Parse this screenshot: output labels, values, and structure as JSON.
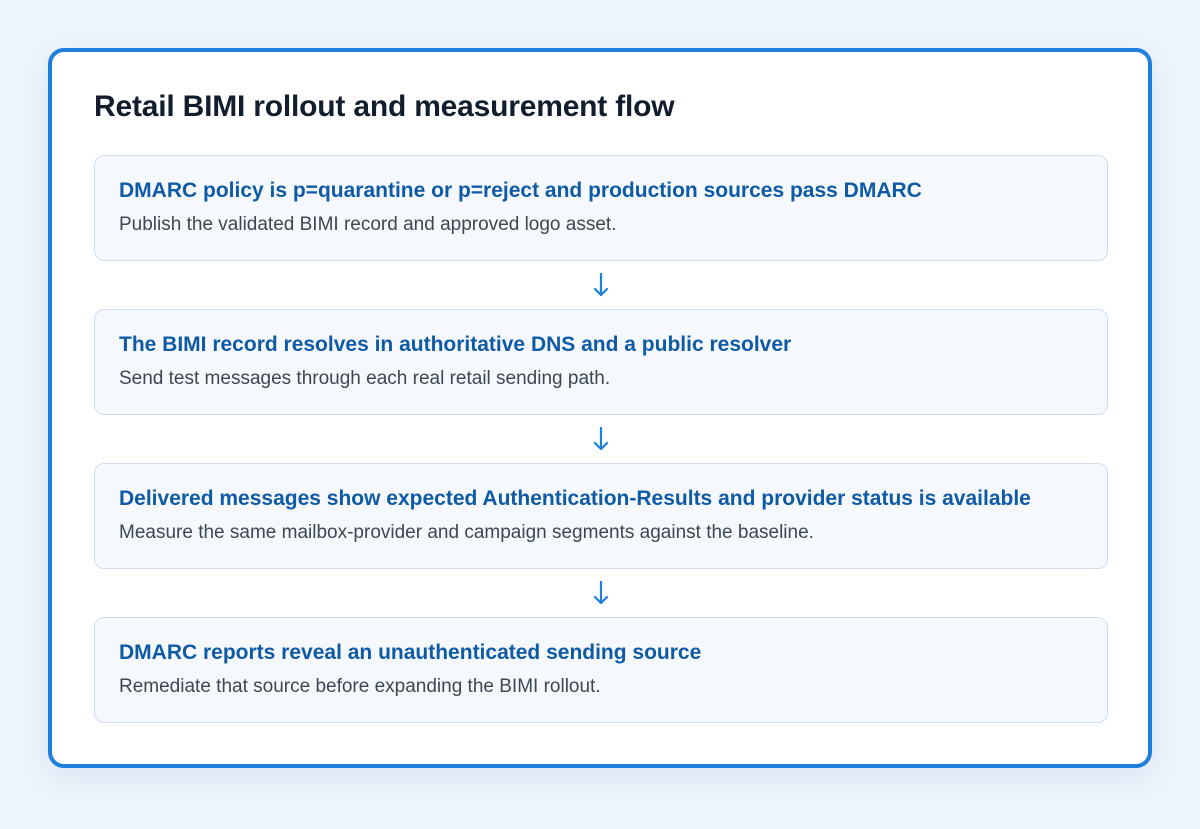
{
  "title": "Retail BIMI rollout and measurement flow",
  "steps": [
    {
      "heading": "DMARC policy is p=quarantine or p=reject and production sources pass DMARC",
      "description": "Publish the validated BIMI record and approved logo asset."
    },
    {
      "heading": "The BIMI record resolves in authoritative DNS and a public resolver",
      "description": "Send test messages through each real retail sending path."
    },
    {
      "heading": "Delivered messages show expected Authentication-Results and provider status is available",
      "description": "Measure the same mailbox-provider and campaign segments against the baseline."
    },
    {
      "heading": "DMARC reports reveal an unauthenticated sending source",
      "description": "Remediate that source before expanding the BIMI rollout."
    }
  ],
  "connector_icon": "arrow-down-icon",
  "colors": {
    "accent": "#1f7fdc",
    "heading": "#0f5aa6",
    "title": "#121e2e",
    "body_text": "#3d4652",
    "step_background": "#f5f9fd",
    "step_border": "#cfdff0"
  }
}
